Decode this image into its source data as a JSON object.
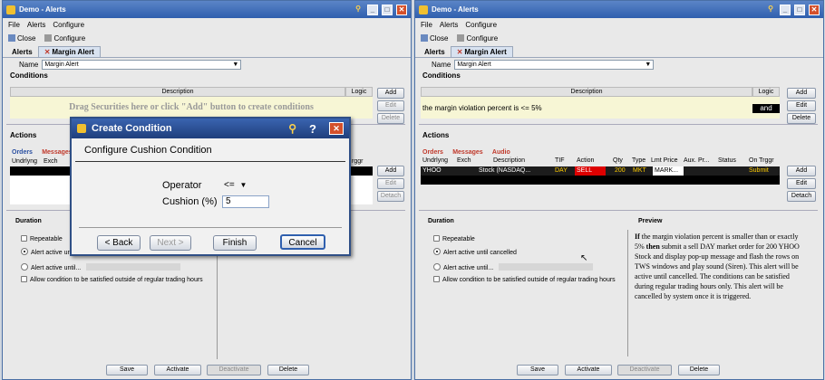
{
  "left": {
    "title": "Demo - Alerts",
    "menu": [
      "File",
      "Alerts",
      "Configure"
    ],
    "toolbar": {
      "close": "Close",
      "configure": "Configure"
    },
    "tabs": {
      "alerts": "Alerts",
      "margin": "Margin Alert"
    },
    "name_label": "Name",
    "name_value": "Margin Alert",
    "conditions_label": "Conditions",
    "description_header": "Description",
    "logic_header": "Logic",
    "drag_hint": "Drag Securities here or click \"Add\" button to create conditions",
    "buttons": {
      "add": "Add",
      "edit": "Edit",
      "delete": "Delete"
    },
    "actions_label": "Actions",
    "subtabs": {
      "orders": "Orders",
      "messages": "Messages"
    },
    "grid_headers": {
      "underlying": "Undrlyng",
      "exch": "Exch",
      "trigger": "rggr"
    },
    "action_buttons": {
      "add": "Add",
      "edit": "Edit",
      "detach": "Detach"
    },
    "duration_label": "Duration",
    "repeatable": "Repeatable",
    "until_cancelled": "Alert active unti",
    "active_until": "Alert active until...",
    "allow_outside": "Allow condition to be satisfied outside of regular trading hours",
    "footer": {
      "save": "Save",
      "activate": "Activate",
      "deactivate": "Deactivate",
      "delete": "Delete"
    }
  },
  "dialog": {
    "title": "Create Condition",
    "subtitle": "Configure Cushion Condition",
    "operator_label": "Operator",
    "operator_value": "<=",
    "cushion_label": "Cushion (%)",
    "cushion_value": "5",
    "back": "< Back",
    "next": "Next >",
    "finish": "Finish",
    "cancel": "Cancel"
  },
  "right": {
    "title": "Demo - Alerts",
    "menu": [
      "File",
      "Alerts",
      "Configure"
    ],
    "toolbar": {
      "close": "Close",
      "configure": "Configure"
    },
    "tabs": {
      "alerts": "Alerts",
      "margin": "Margin Alert"
    },
    "name_label": "Name",
    "name_value": "Margin Alert",
    "conditions_label": "Conditions",
    "description_header": "Description",
    "logic_header": "Logic",
    "condition_text": "the margin violation percent is <= 5%",
    "logic_value": "and",
    "buttons": {
      "add": "Add",
      "edit": "Edit",
      "delete": "Delete"
    },
    "actions_label": "Actions",
    "subtabs": {
      "orders": "Orders",
      "messages": "Messages",
      "audio": "Audio"
    },
    "grid_headers": [
      "Undrlyng",
      "Exch",
      "Description",
      "TIF",
      "Action",
      "Qty",
      "Type",
      "Lmt Price",
      "Aux. Pr...",
      "Status",
      "On Trggr"
    ],
    "order_row": {
      "underlying": "YHOO",
      "exch": "",
      "description": "Stock (NASDAQ...",
      "tif": "DAY",
      "action": "SELL",
      "qty": "200",
      "type": "MKT",
      "lmt": "MARK...",
      "aux": "",
      "status": "",
      "trigger": "Submit"
    },
    "action_buttons": {
      "add": "Add",
      "edit": "Edit",
      "detach": "Detach"
    },
    "duration_label": "Duration",
    "preview_label": "Preview",
    "repeatable": "Repeatable",
    "until_cancelled": "Alert active until cancelled",
    "active_until": "Alert active until...",
    "allow_outside": "Allow condition to be satisfied outside of regular trading hours",
    "preview_lines": [
      {
        "a": "If",
        "b": " the margin violation percent is smaller than or exactly"
      },
      {
        "a": "5%",
        "b": " "
      },
      {
        "a": "then",
        "b": " submit a sell DAY market order for 200 YHOO"
      },
      {
        "a": "",
        "b": "Stock and display pop-up message and flash the rows on"
      },
      {
        "a": "",
        "b": "TWS windows and play sound (Siren). This alert will be"
      },
      {
        "a": "",
        "b": "active until cancelled. The conditions can be satisfied"
      },
      {
        "a": "",
        "b": "during regular trading hours only. This alert will be"
      },
      {
        "a": "",
        "b": "cancelled by system once it is triggered."
      }
    ],
    "footer": {
      "save": "Save",
      "activate": "Activate",
      "deactivate": "Deactivate",
      "delete": "Delete"
    }
  }
}
